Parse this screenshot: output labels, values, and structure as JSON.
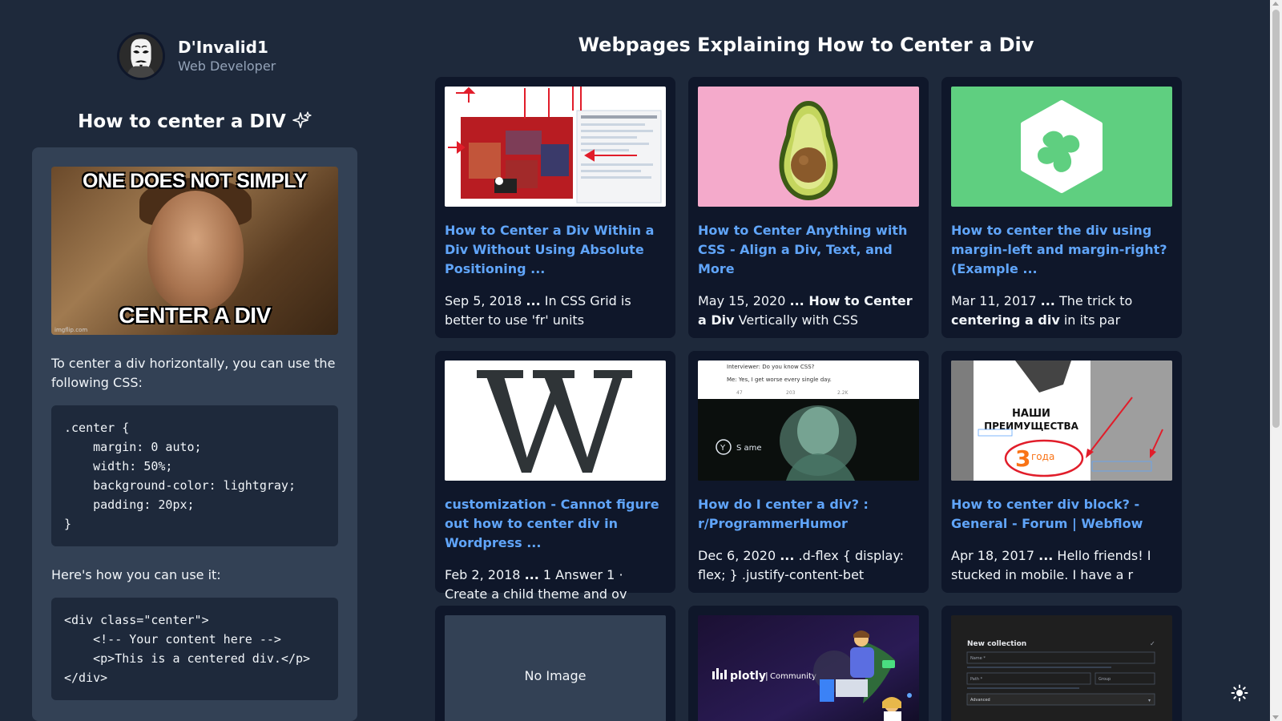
{
  "profile": {
    "name": "D'Invalid1",
    "role": "Web Developer"
  },
  "article": {
    "title": "How to center a DIV",
    "meme": {
      "top_text": "ONE DOES NOT SIMPLY",
      "bottom_text": "CENTER A DIV",
      "watermark": "imgflip.com"
    },
    "intro": "To center a div horizontally, you can use the following CSS:",
    "css_code": ".center {\n    margin: 0 auto;\n    width: 50%;\n    background-color: lightgray;\n    padding: 20px;\n}",
    "usage_intro": "Here's how you can use it:",
    "html_code": "<div class=\"center\">\n    <!-- Your content here -->\n    <p>This is a centered div.</p>\n</div>"
  },
  "results": {
    "heading": "Webpages Explaining How to Center a Div",
    "cards": [
      {
        "thumb": "screenshot-arrows",
        "title": "How to Center a Div Within a Div Without Using Absolute Positioning ...",
        "date": "Sep 5, 2018",
        "snippet_parts": [
          " ",
          "...",
          " In CSS Grid is better to use 'fr' units"
        ]
      },
      {
        "thumb": "avocado",
        "title": "How to Center Anything with CSS - Align a Div, Text, and More",
        "date": "May 15, 2020",
        "snippet_parts": [
          " ",
          "... How to Center a Div",
          " Vertically with CSS"
        ]
      },
      {
        "thumb": "treehouse-logo",
        "title": "How to center the div using margin-left and margin-right? (Example ...",
        "date": "Mar 11, 2017",
        "snippet_parts": [
          " ",
          "...",
          " The trick to ",
          "centering a div",
          " in its par"
        ]
      },
      {
        "thumb": "wikipedia-w",
        "title": "customization - Cannot figure out how to center div in Wordpress ...",
        "date": "Feb 2, 2018",
        "snippet_parts": [
          " ",
          "...",
          " 1 Answer 1 · Create a child theme and ov"
        ]
      },
      {
        "thumb": "tweet-meme",
        "title": "How do I center a div? : r/ProgrammerHumor",
        "date": "Dec 6, 2020",
        "snippet_parts": [
          " ",
          "...",
          " .d-flex { display: flex; } .justify-content-bet"
        ],
        "thumb_text": {
          "line1": "Interviewer: Do you know CSS?",
          "line2": "Me: Yes, I get worse every single day.",
          "handle": "S  ame",
          "stats": [
            "47",
            "203",
            "2.2K"
          ]
        }
      },
      {
        "thumb": "russian-banner",
        "title": "How to center div block? - General - Forum | Webflow",
        "date": "Apr 18, 2017",
        "snippet_parts": [
          " ",
          "...",
          " Hello friends! I stucked in mobile. I have a r"
        ],
        "thumb_text": {
          "line1": "НАШИ",
          "line2": "ПРЕИМУЩЕСТВА",
          "big": "3",
          "word": "года"
        }
      },
      {
        "thumb": "none",
        "no_image": "No Image"
      },
      {
        "thumb": "plotly-community",
        "thumb_text": {
          "brand": "plotly",
          "sub": "Community"
        }
      },
      {
        "thumb": "new-collection-form",
        "thumb_text": {
          "heading": "New collection",
          "field1": "Name *",
          "field2": "Path *",
          "field3": "Group",
          "select": "Advanced"
        }
      }
    ]
  },
  "controls": {
    "theme_toggle_icon": "sun-icon"
  },
  "colors": {
    "background": "#1e293b",
    "card": "#0f172a",
    "panel": "#334155",
    "link": "#60a5fa"
  }
}
